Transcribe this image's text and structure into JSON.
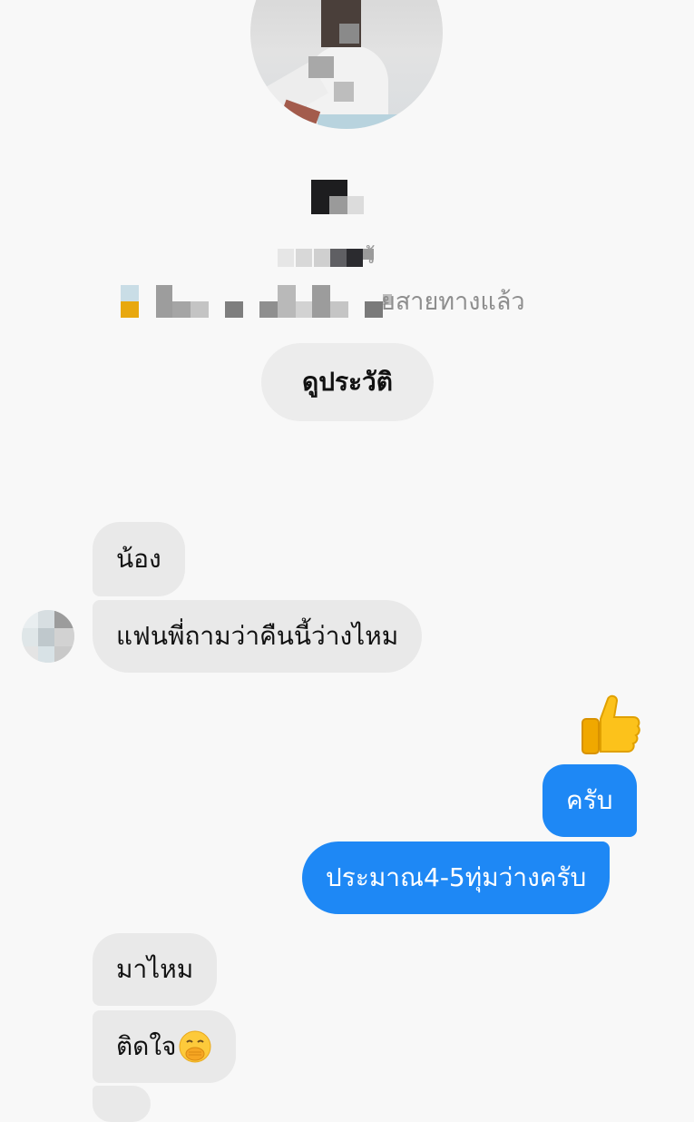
{
  "profile": {
    "name": "",
    "subtitle": "ว้",
    "status_text": "ยสายทางแล้ว",
    "history_button_label": "ดูประวัติ"
  },
  "messages": [
    {
      "direction": "in",
      "text": "น้อง"
    },
    {
      "direction": "in",
      "text": "แฟนพี่ถามว่าคืนนี้ว่างไหม"
    },
    {
      "direction": "out",
      "reaction_icon": "thumbs-up-icon"
    },
    {
      "direction": "out",
      "text": "ครับ"
    },
    {
      "direction": "out",
      "text": "ประมาณ4-5ทุ่มว่างครับ"
    },
    {
      "direction": "in",
      "text": "มาไหม"
    },
    {
      "direction": "in",
      "text": "ติดใจ",
      "emoji": "face-with-hand-over-mouth-icon"
    }
  ],
  "colors": {
    "background": "#f8f8f8",
    "incoming_bubble": "#e9e9e9",
    "outgoing_bubble": "#1e88f5",
    "history_button": "#ececec"
  }
}
